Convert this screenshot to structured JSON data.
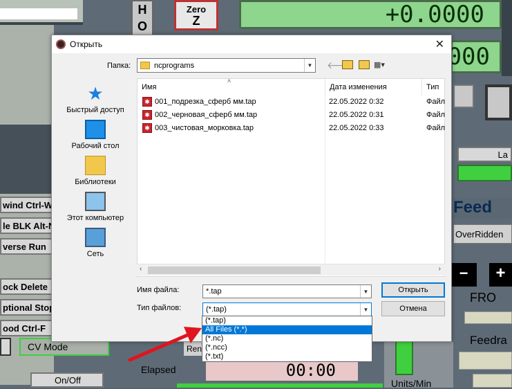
{
  "dialog": {
    "title": "Открыть",
    "folder_label": "Папка:",
    "folder_value": "ncprograms",
    "places": [
      {
        "label": "Быстрый доступ",
        "icon": "star-icon"
      },
      {
        "label": "Рабочий стол",
        "icon": "desktop-icon"
      },
      {
        "label": "Библиотеки",
        "icon": "libraries-icon"
      },
      {
        "label": "Этот компьютер",
        "icon": "computer-icon"
      },
      {
        "label": "Сеть",
        "icon": "network-icon"
      }
    ],
    "columns": {
      "name": "Имя",
      "date": "Дата изменения",
      "type": "Тип"
    },
    "files": [
      {
        "name": "001_подрезка_сферб мм.tap",
        "date": "22.05.2022 0:32",
        "type": "Файл"
      },
      {
        "name": "002_черновая_сферб мм.tap",
        "date": "22.05.2022 0:31",
        "type": "Файл"
      },
      {
        "name": "003_чистовая_морковка.tap",
        "date": "22.05.2022 0:33",
        "type": "Файл"
      }
    ],
    "filename_label": "Имя файла:",
    "filename_value": "*.tap",
    "filetype_label": "Тип файлов:",
    "filetype_value": "(*.tap)",
    "open_button": "Открыть",
    "cancel_button": "Отмена",
    "filetype_options": [
      "(*.tap)",
      "All Files (*.*)",
      "(*.nc)",
      "(*.ncc)",
      "(*.txt)"
    ],
    "selected_option_index": 1
  },
  "background": {
    "zero_z": "Zero\nZ",
    "zero_z_top": "Zero",
    "zero_z_bottom": "Z",
    "dro_top": "+0.0000",
    "dro_second": "000",
    "side_letters": [
      "H",
      "O"
    ],
    "rewind": "wind Ctrl-W",
    "single_block": "le BLK Alt-N",
    "reverse_run": "verse Run",
    "block_delete": "ock Delete",
    "optional_stop": "ptional Stop",
    "flood": "ood Ctrl-F",
    "cv_mode": "CV Mode",
    "on_off": "On/Off",
    "elapsed_label": "Elapsed",
    "elapsed_value": "00:00",
    "rem_label": "Ren",
    "feed": "Feed",
    "overridden": "OverRidden",
    "fro": "FRO",
    "feedrate": "Feedra",
    "units_min": "Units/Min",
    "la": "La",
    "plus": "+",
    "minus": "−"
  },
  "colors": {
    "accent": "#0078d7",
    "dro_green": "#8ed58e",
    "arrow_red": "#e0141e"
  }
}
